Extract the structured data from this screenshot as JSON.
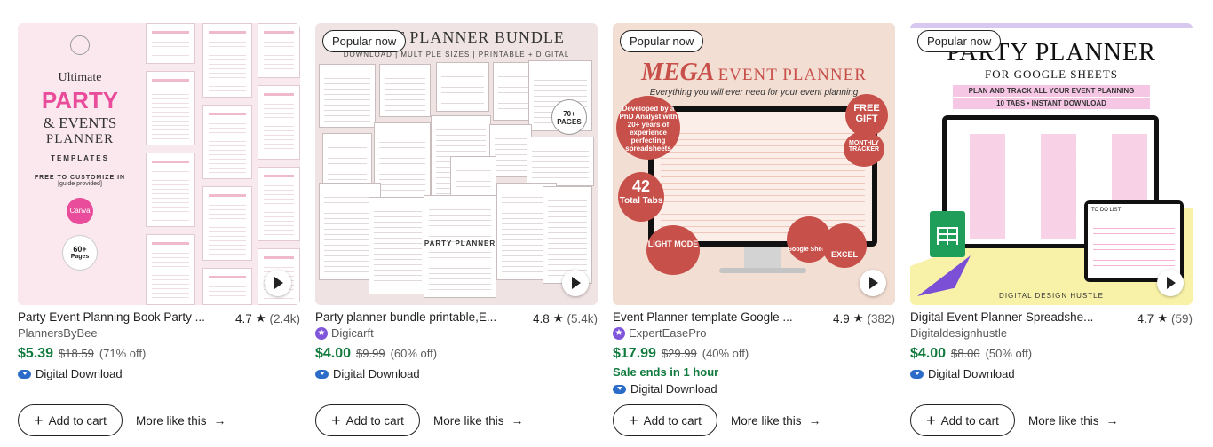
{
  "listings": [
    {
      "title": "Party Event Planning Book Party ...",
      "rating": "4.7",
      "reviews": "(2.4k)",
      "shop": "PlannersByBee",
      "star_seller": false,
      "price": "$5.39",
      "original_price": "$18.59",
      "discount": "(71% off)",
      "sale_note": "",
      "download": "Digital Download",
      "badge": "",
      "add_to_cart": "Add to cart",
      "more_like_this": "More like this",
      "thumb_text": {
        "ultimate": "Ultimate",
        "party": "PARTY",
        "events": "& EVENTS",
        "planner": "PLANNER",
        "templates": "TEMPLATES",
        "free": "FREE TO CUSTOMIZE IN",
        "guide": "[guide provided]",
        "canva": "Canva",
        "pages_num": "60+",
        "pages": "Pages"
      }
    },
    {
      "title": "Party planner bundle printable,E...",
      "rating": "4.8",
      "reviews": "(5.4k)",
      "shop": "Digicarft",
      "star_seller": true,
      "price": "$4.00",
      "original_price": "$9.99",
      "discount": "(60% off)",
      "sale_note": "",
      "download": "Digital Download",
      "badge": "Popular now",
      "add_to_cart": "Add to cart",
      "more_like_this": "More like this",
      "thumb_text": {
        "heading": "EVENT PLANNER BUNDLE",
        "subheading": "DOWNLOAD | MULTIPLE SIZES | PRINTABLE + DIGITAL",
        "pages_num": "70+",
        "pages": "PAGES",
        "party_planner": "PARTY PLANNER"
      }
    },
    {
      "title": "Event Planner template Google ...",
      "rating": "4.9",
      "reviews": "(382)",
      "shop": "ExpertEasePro",
      "star_seller": true,
      "price": "$17.99",
      "original_price": "$29.99",
      "discount": "(40% off)",
      "sale_note": "Sale ends in 1 hour",
      "download": "Digital Download",
      "badge": "Popular now",
      "add_to_cart": "Add to cart",
      "more_like_this": "More like this",
      "thumb_text": {
        "mega": "MEGA",
        "event_planner": "EVENT PLANNER",
        "tagline": "Everything you will ever need for your event planning",
        "phd": "Developed by a PhD Analyst with 20+ years of experience perfecting spreadsheets",
        "free_gift": "FREE GIFT",
        "monthly": "MONTHLY TRACKER",
        "tabs_num": "42",
        "tabs": "Total Tabs",
        "light": "LIGHT MODE",
        "google_sheets": "Google Sheets",
        "excel": "EXCEL"
      }
    },
    {
      "title": "Digital Event Planner Spreadshe...",
      "rating": "4.7",
      "reviews": "(59)",
      "shop": "Digitaldesignhustle",
      "star_seller": false,
      "price": "$4.00",
      "original_price": "$8.00",
      "discount": "(50% off)",
      "sale_note": "",
      "download": "Digital Download",
      "badge": "Popular now",
      "add_to_cart": "Add to cart",
      "more_like_this": "More like this",
      "thumb_text": {
        "party_planner": "PARTY PLANNER",
        "for_google": "FOR GOOGLE SHEETS",
        "line1": "PLAN AND TRACK ALL YOUR EVENT PLANNING",
        "line2": "10 TABS • INSTANT DOWNLOAD",
        "todo": "TO DO LIST",
        "brand": "DIGITAL DESIGN HUSTLE"
      }
    }
  ],
  "icons": {
    "star": "★",
    "plus": "+",
    "arrow": "→",
    "play": "play-icon",
    "cloud": "cloud-download-icon",
    "star_seller": "star-seller-icon"
  },
  "colors": {
    "price_green": "#0f7a3c",
    "text": "#222222",
    "muted": "#595959",
    "star_seller": "#7f56d9",
    "download_blue": "#2b6cc8"
  }
}
